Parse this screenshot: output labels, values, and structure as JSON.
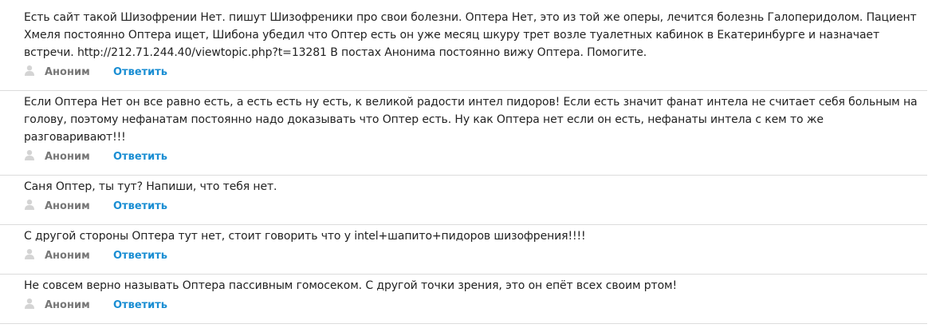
{
  "comments": [
    {
      "text": "Есть сайт такой Шизофрении Нет. пишут Шизофреники про свои болезни. Оптера Нет, это из той же оперы, лечится болезнь Галоперидолом. Пациент Хмеля постоянно Оптера ищет, Шибона убедил что Оптер есть он уже месяц шкуру трет возле туалетных кабинок в Екатеринбурге и назначает встречи. http://212.71.244.40/viewtopic.php?t=13281 В постах Анонима постоянно вижу Оптера. Помогите.",
      "author": "Аноним",
      "reply": "Ответить"
    },
    {
      "text": "Если Оптера Нет он все равно есть, а есть есть ну есть, к великой радости интел пидоров! Если есть значит фанат интела не считает себя больным на голову, поэтому нефанатам постоянно надо доказывать что Оптер есть. Ну как Оптера нет если он есть, нефанаты интела с кем то же разговаривают!!!",
      "author": "Аноним",
      "reply": "Ответить"
    },
    {
      "text": "Саня Оптер, ты тут? Напиши, что тебя нет.",
      "author": "Аноним",
      "reply": "Ответить"
    },
    {
      "text": "С другой стороны Оптера тут нет, стоит говорить что у intel+шапито+пидоров шизофрения!!!!",
      "author": "Аноним",
      "reply": "Ответить"
    },
    {
      "text": "Не совсем верно называть Оптера пассивным гомосеком. С другой точки зрения, это он епёт всех своим ртом!",
      "author": "Аноним",
      "reply": "Ответить"
    }
  ],
  "icons": {
    "user": "user-icon"
  },
  "colors": {
    "author": "#777777",
    "reply_link": "#1a8ed3",
    "divider": "#dcdcdc"
  }
}
